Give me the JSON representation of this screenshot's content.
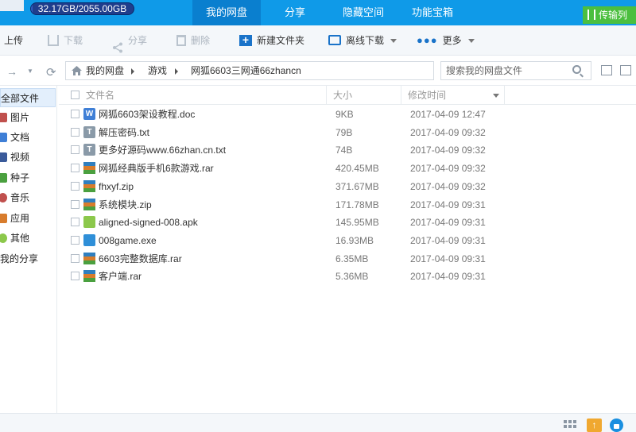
{
  "top": {
    "storage_text": "32.17GB/2055.00GB",
    "storage_used_fraction": 0.016,
    "tabs": [
      {
        "label": "我的网盘",
        "active": true
      },
      {
        "label": "分享",
        "active": false
      },
      {
        "label": "隐藏空间",
        "active": false
      },
      {
        "label": "功能宝箱",
        "active": false
      }
    ],
    "transfer_label": "传输列表"
  },
  "toolbar": {
    "upload": "上传",
    "download": "下载",
    "share": "分享",
    "delete": "删除",
    "new_folder": "新建文件夹",
    "offline_download": "离线下载",
    "more": "更多"
  },
  "address": {
    "crumbs": [
      "我的网盘",
      "游戏",
      "网狐6603三网通66zhancn"
    ],
    "search_placeholder": "搜索我的网盘文件"
  },
  "sidebar": {
    "items": [
      {
        "label": "全部文件",
        "icon": "all-files-icon",
        "active": true
      },
      {
        "label": "图片",
        "icon": "picture-icon",
        "color": "#c0504d"
      },
      {
        "label": "文档",
        "icon": "document-icon",
        "color": "#3f7fd6"
      },
      {
        "label": "视频",
        "icon": "video-icon",
        "color": "#3a5a9a"
      },
      {
        "label": "种子",
        "icon": "torrent-icon",
        "color": "#4aa03f"
      },
      {
        "label": "音乐",
        "icon": "music-icon",
        "color": "#c0504d"
      },
      {
        "label": "应用",
        "icon": "app-icon",
        "color": "#d87c2c"
      },
      {
        "label": "其他",
        "icon": "other-icon",
        "color": "#8cc84b"
      },
      {
        "label": "我的分享",
        "icon": "",
        "active": false
      }
    ]
  },
  "list": {
    "headers": {
      "name": "文件名",
      "size": "大小",
      "modified": "修改时间"
    },
    "files": [
      {
        "name": "网狐6603架设教程.doc",
        "size": "9KB",
        "date": "2017-04-09 12:47",
        "type": "doc",
        "glyph": "W"
      },
      {
        "name": "解压密码.txt",
        "size": "79B",
        "date": "2017-04-09 09:32",
        "type": "txt",
        "glyph": "T"
      },
      {
        "name": "更多好源码www.66zhan.cn.txt",
        "size": "74B",
        "date": "2017-04-09 09:32",
        "type": "txt",
        "glyph": "T"
      },
      {
        "name": "网狐经典版手机6款游戏.rar",
        "size": "420.45MB",
        "date": "2017-04-09 09:32",
        "type": "rar",
        "glyph": ""
      },
      {
        "name": "fhxyf.zip",
        "size": "371.67MB",
        "date": "2017-04-09 09:32",
        "type": "rar",
        "glyph": ""
      },
      {
        "name": "系统模块.zip",
        "size": "171.78MB",
        "date": "2017-04-09 09:31",
        "type": "rar",
        "glyph": ""
      },
      {
        "name": "aligned-signed-008.apk",
        "size": "145.95MB",
        "date": "2017-04-09 09:31",
        "type": "apk",
        "glyph": ""
      },
      {
        "name": "008game.exe",
        "size": "16.93MB",
        "date": "2017-04-09 09:31",
        "type": "exe",
        "glyph": ""
      },
      {
        "name": "6603完整数据库.rar",
        "size": "6.35MB",
        "date": "2017-04-09 09:31",
        "type": "rar",
        "glyph": ""
      },
      {
        "name": "客户端.rar",
        "size": "5.36MB",
        "date": "2017-04-09 09:31",
        "type": "rar",
        "glyph": ""
      }
    ]
  },
  "colors": {
    "topbar": "#0f9ae8",
    "active_tab": "#0a7fcf",
    "transfer": "#4bbf3f"
  }
}
